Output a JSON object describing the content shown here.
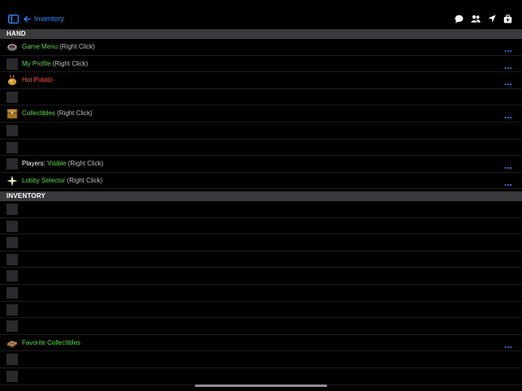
{
  "header": {
    "title": "Inventory"
  },
  "colors": {
    "accent": "#2f8bff",
    "green": "#5ad84d",
    "red": "#ff5a3c",
    "gray": "#bdbdbd",
    "white": "#ffffff"
  },
  "hand": {
    "title": "HAND",
    "rows": [
      {
        "icon": "compass-icon",
        "parts": [
          {
            "text": "Game Menu",
            "color": "#5ad84d"
          },
          {
            "text": " (Right Click)",
            "color": "#bdbdbd"
          }
        ],
        "more": true
      },
      {
        "icon": "empty-slot",
        "parts": [
          {
            "text": "My Profile",
            "color": "#5ad84d"
          },
          {
            "text": " (Right Click)",
            "color": "#bdbdbd"
          }
        ],
        "more": true
      },
      {
        "icon": "potato-icon",
        "parts": [
          {
            "text": "Hot Potato",
            "color": "#ff5a3c"
          }
        ],
        "more": true
      },
      {
        "icon": "empty-slot",
        "parts": [],
        "more": false
      },
      {
        "icon": "chest-icon",
        "parts": [
          {
            "text": "Collectibles",
            "color": "#5ad84d"
          },
          {
            "text": " (Right Click)",
            "color": "#bdbdbd"
          }
        ],
        "more": true
      },
      {
        "icon": "empty-slot",
        "parts": [],
        "more": false
      },
      {
        "icon": "empty-slot",
        "parts": [],
        "more": false
      },
      {
        "icon": "empty-slot",
        "parts": [
          {
            "text": "Players: ",
            "color": "#ffffff"
          },
          {
            "text": "Visible",
            "color": "#5ad84d"
          },
          {
            "text": " (Right Click)",
            "color": "#bdbdbd"
          }
        ],
        "more": true
      },
      {
        "icon": "nether-star-icon",
        "parts": [
          {
            "text": "Lobby Selector",
            "color": "#5ad84d"
          },
          {
            "text": " (Right Click)",
            "color": "#bdbdbd"
          }
        ],
        "more": true
      }
    ]
  },
  "inventory": {
    "title": "INVENTORY",
    "rows": [
      {
        "icon": "empty-slot",
        "parts": [],
        "more": false
      },
      {
        "icon": "empty-slot",
        "parts": [],
        "more": false
      },
      {
        "icon": "empty-slot",
        "parts": [],
        "more": false
      },
      {
        "icon": "empty-slot",
        "parts": [],
        "more": false
      },
      {
        "icon": "empty-slot",
        "parts": [],
        "more": false
      },
      {
        "icon": "empty-slot",
        "parts": [],
        "more": false
      },
      {
        "icon": "empty-slot",
        "parts": [],
        "more": false
      },
      {
        "icon": "empty-slot",
        "parts": [],
        "more": false
      },
      {
        "icon": "book-icon",
        "parts": [
          {
            "text": "Favorite Collectibles",
            "color": "#5ad84d"
          }
        ],
        "more": true
      },
      {
        "icon": "empty-slot",
        "parts": [],
        "more": false
      },
      {
        "icon": "empty-slot",
        "parts": [],
        "more": false
      }
    ]
  }
}
